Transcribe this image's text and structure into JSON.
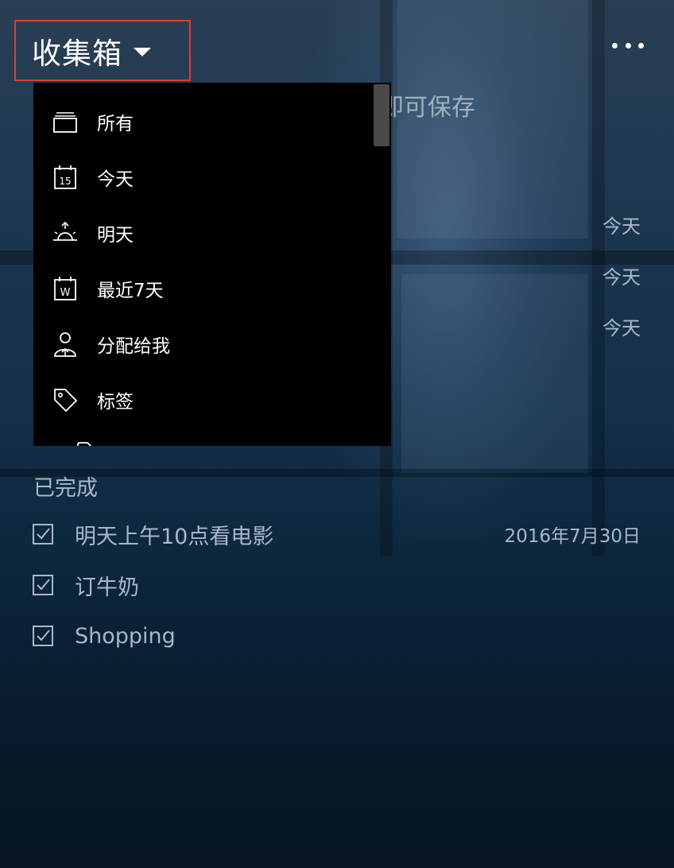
{
  "header": {
    "title": "收集箱",
    "more_icon": "more-horizontal-icon"
  },
  "hint_text": "即可保存",
  "task_dates": [
    "今天",
    "今天",
    "今天"
  ],
  "menu": {
    "items": [
      {
        "label": "所有",
        "icon": "inbox-stack-icon"
      },
      {
        "label": "今天",
        "icon": "calendar-15-icon"
      },
      {
        "label": "明天",
        "icon": "sunrise-icon"
      },
      {
        "label": "最近7天",
        "icon": "calendar-week-icon"
      },
      {
        "label": "分配给我",
        "icon": "person-assign-icon"
      },
      {
        "label": "标签",
        "icon": "tag-icon"
      }
    ]
  },
  "completed": {
    "title": "已完成",
    "tasks": [
      {
        "text": "明天上午10点看电影",
        "date": "2016年7月30日"
      },
      {
        "text": "订牛奶",
        "date": ""
      },
      {
        "text": "Shopping",
        "date": ""
      }
    ]
  },
  "colors": {
    "highlight_border": "#e53935",
    "menu_background": "#000000",
    "muted_text": "#a9b8c8"
  }
}
